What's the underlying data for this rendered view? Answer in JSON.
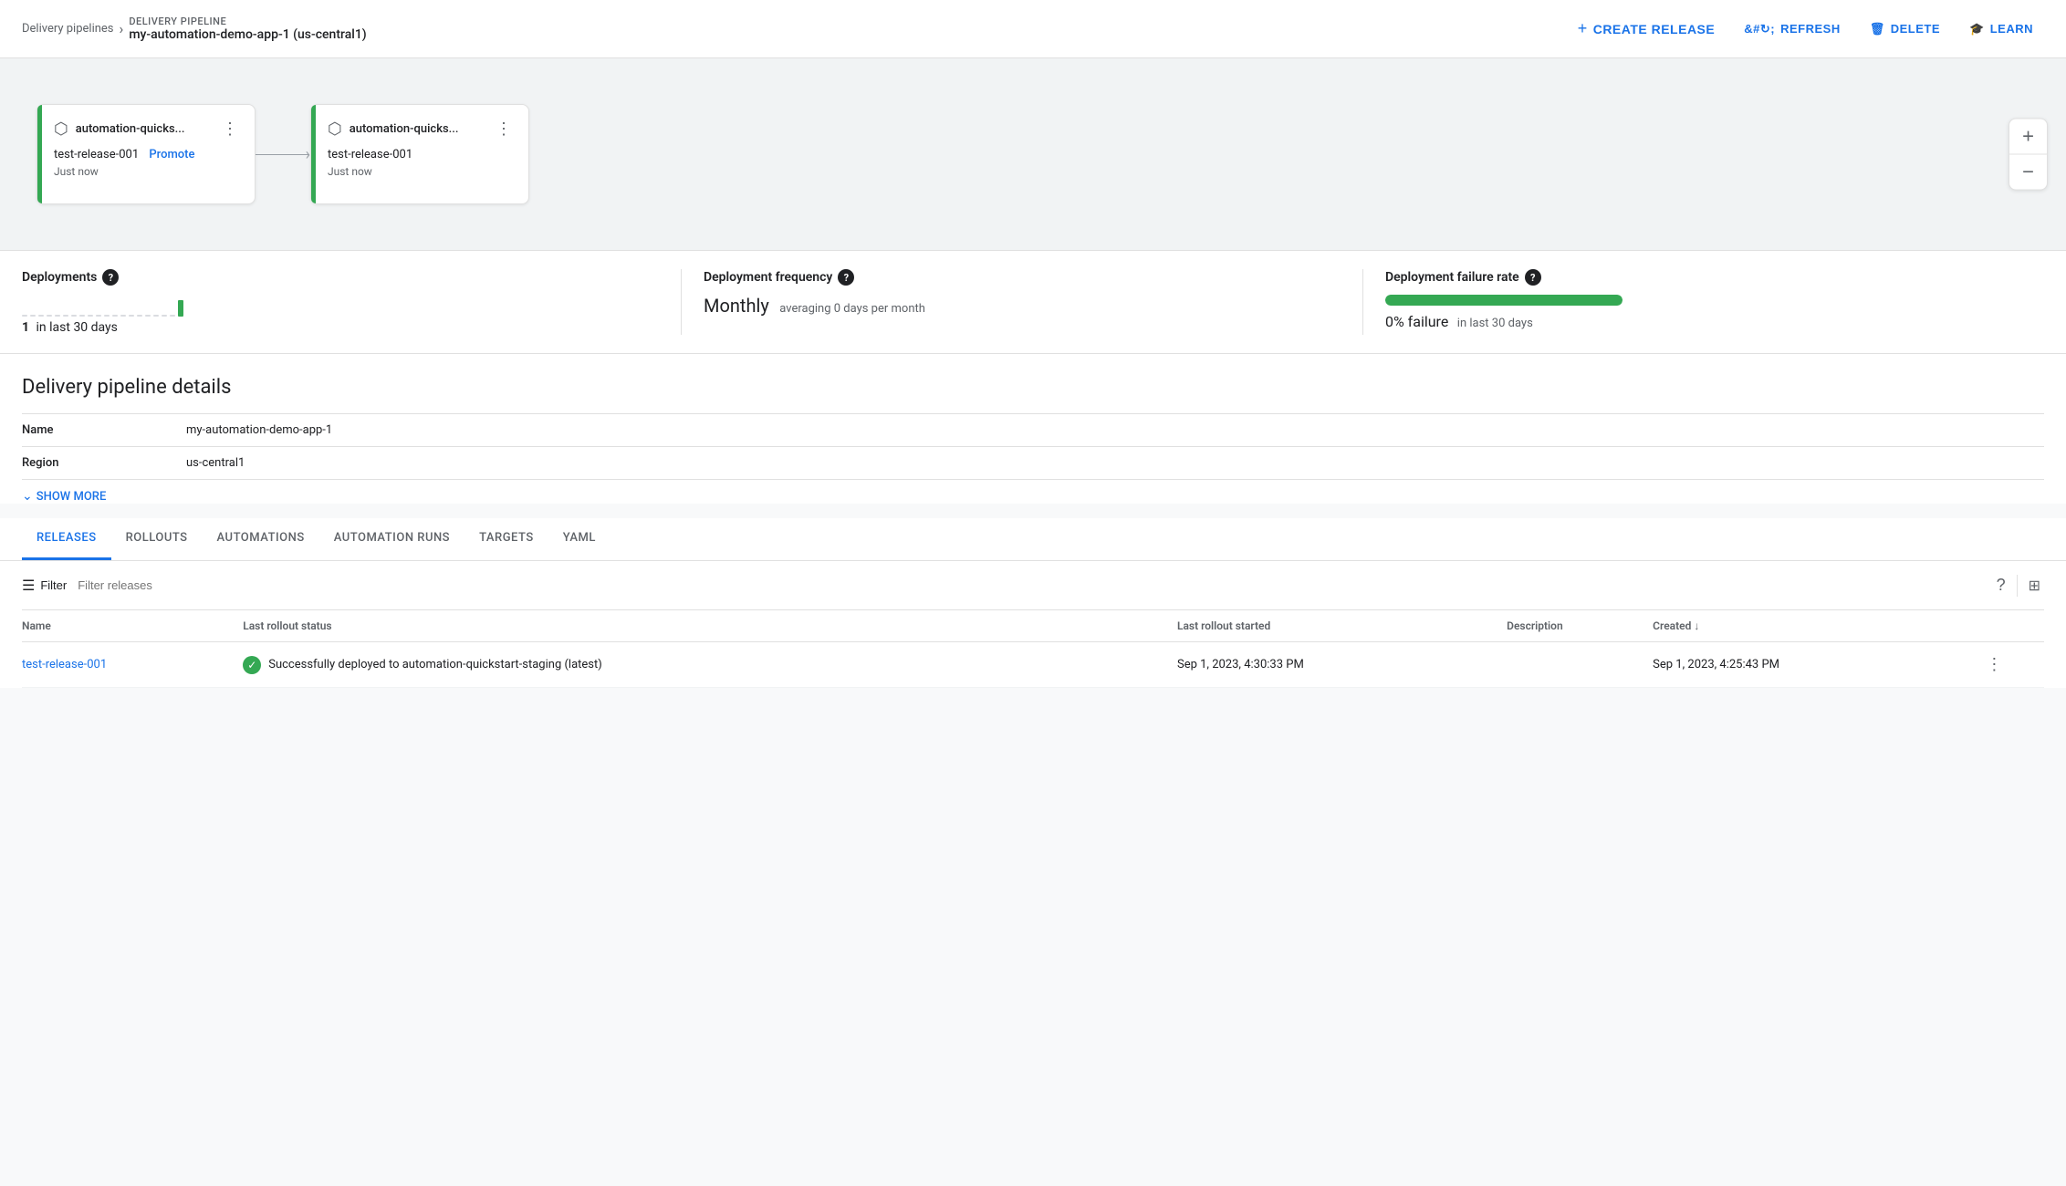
{
  "topbar": {
    "breadcrumb_link": "Delivery pipelines",
    "pipeline_label": "DELIVERY PIPELINE",
    "pipeline_name": "my-automation-demo-app-1 (us-central1)",
    "create_release": "CREATE RELEASE",
    "refresh": "REFRESH",
    "delete": "DELETE",
    "learn": "LEARN"
  },
  "pipeline": {
    "stages": [
      {
        "name": "automation-quicks...",
        "release": "test-release-001",
        "time": "Just now",
        "has_promote": true
      },
      {
        "name": "automation-quicks...",
        "release": "test-release-001",
        "time": "Just now",
        "has_promote": false
      }
    ]
  },
  "metrics": {
    "deployments_label": "Deployments",
    "deployments_count": "1",
    "deployments_suffix": "in last 30 days",
    "frequency_label": "Deployment frequency",
    "frequency_value": "Monthly",
    "frequency_sub": "averaging 0 days per month",
    "failure_label": "Deployment failure rate",
    "failure_bar_pct": 100,
    "failure_value": "0% failure",
    "failure_sub": "in last 30 days"
  },
  "details": {
    "section_title": "Delivery pipeline details",
    "fields": [
      {
        "key": "Name",
        "value": "my-automation-demo-app-1"
      },
      {
        "key": "Region",
        "value": "us-central1"
      }
    ],
    "show_more": "SHOW MORE"
  },
  "tabs": {
    "items": [
      {
        "label": "RELEASES",
        "active": true
      },
      {
        "label": "ROLLOUTS",
        "active": false
      },
      {
        "label": "AUTOMATIONS",
        "active": false
      },
      {
        "label": "AUTOMATION RUNS",
        "active": false
      },
      {
        "label": "TARGETS",
        "active": false
      },
      {
        "label": "YAML",
        "active": false
      }
    ]
  },
  "releases_table": {
    "filter_placeholder": "Filter releases",
    "columns": [
      {
        "label": "Name",
        "sortable": false
      },
      {
        "label": "Last rollout status",
        "sortable": false
      },
      {
        "label": "Last rollout started",
        "sortable": false
      },
      {
        "label": "Description",
        "sortable": false
      },
      {
        "label": "Created",
        "sortable": true
      }
    ],
    "rows": [
      {
        "name": "test-release-001",
        "status": "Successfully deployed to automation-quickstart-staging (latest)",
        "rollout_started": "Sep 1, 2023, 4:30:33 PM",
        "description": "",
        "created": "Sep 1, 2023, 4:25:43 PM"
      }
    ]
  }
}
